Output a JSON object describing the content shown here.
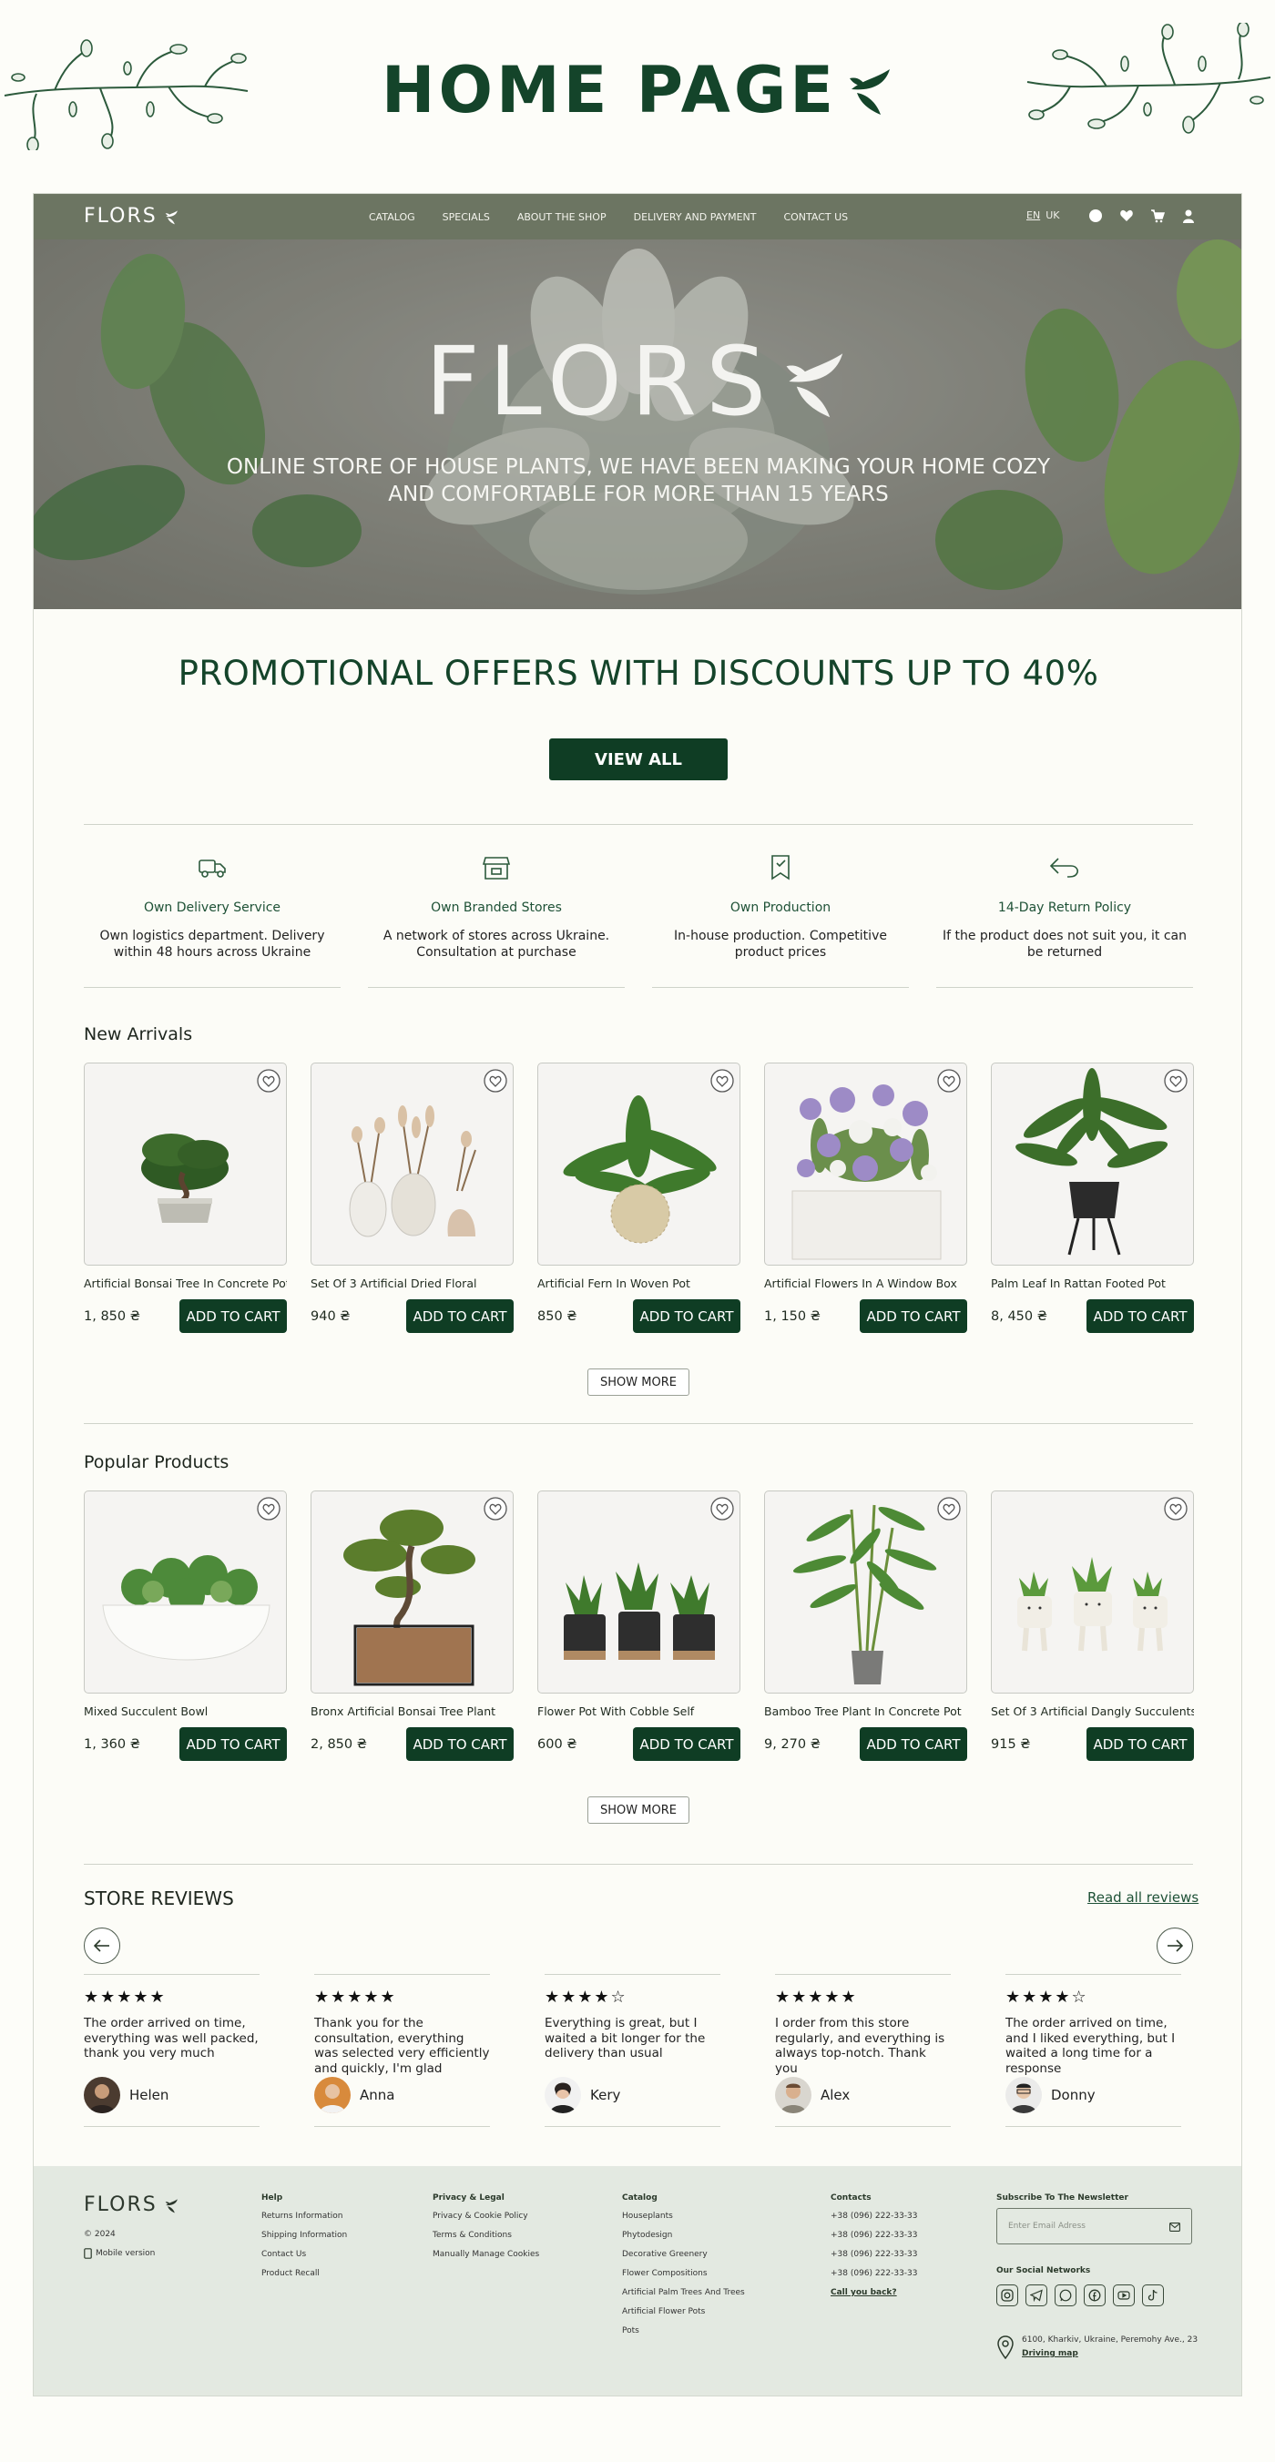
{
  "page_title": "HOME PAGE",
  "header": {
    "logo": "FLORS",
    "nav": [
      "CATALOG",
      "SPECIALS",
      "ABOUT THE SHOP",
      "DELIVERY AND PAYMENT",
      "CONTACT US"
    ],
    "lang": [
      "EN",
      "UK"
    ],
    "icons": [
      "search-icon",
      "heart-icon",
      "cart-icon",
      "user-icon"
    ]
  },
  "hero": {
    "logo": "FLORS",
    "text": "ONLINE STORE OF HOUSE PLANTS, WE HAVE BEEN MAKING YOUR HOME COZY AND COMFORTABLE FOR MORE THAN 15 YEARS"
  },
  "promo": {
    "title": "PROMOTIONAL OFFERS WITH DISCOUNTS UP TO 40%",
    "button": "VIEW ALL"
  },
  "features": [
    {
      "icon": "delivery-truck-icon",
      "title": "Own Delivery Service",
      "text": "Own logistics department. Delivery within 48 hours across Ukraine"
    },
    {
      "icon": "store-icon",
      "title": "Own Branded Stores",
      "text": "A network of stores across Ukraine. Consultation at purchase"
    },
    {
      "icon": "production-tag-icon",
      "title": "Own Production",
      "text": "In-house production. Competitive product prices"
    },
    {
      "icon": "return-arrow-icon",
      "title": "14-Day Return Policy",
      "text": "If the product does not suit you, it can be returned"
    }
  ],
  "new_arrivals": {
    "title": "New Arrivals",
    "show_more": "SHOW MORE",
    "items": [
      {
        "name": "Artificial Bonsai Tree In Concrete Pot",
        "price": "1, 850 ₴",
        "button": "ADD TO CART"
      },
      {
        "name": "Set Of 3 Artificial Dried Floral",
        "price": "940 ₴",
        "button": "ADD TO CART"
      },
      {
        "name": "Artificial Fern In Woven Pot",
        "price": "850 ₴",
        "button": "ADD TO CART"
      },
      {
        "name": "Artificial Flowers In A Window Box",
        "price": "1, 150 ₴",
        "button": "ADD TO CART"
      },
      {
        "name": "Palm Leaf In Rattan Footed Pot",
        "price": "8, 450 ₴",
        "button": "ADD TO CART"
      }
    ]
  },
  "popular": {
    "title": "Popular Products",
    "show_more": "SHOW MORE",
    "items": [
      {
        "name": "Mixed Succulent Bowl",
        "price": "1, 360 ₴",
        "button": "ADD TO CART"
      },
      {
        "name": "Bronx Artificial Bonsai Tree Plant",
        "price": "2, 850 ₴",
        "button": "ADD TO CART"
      },
      {
        "name": "Flower Pot With Cobble Self",
        "price": "600 ₴",
        "button": "ADD TO CART"
      },
      {
        "name": "Bamboo Tree Plant In Concrete Pot",
        "price": "9, 270 ₴",
        "button": "ADD TO CART"
      },
      {
        "name": "Set Of 3 Artificial Dangly Succulents",
        "price": "915 ₴",
        "button": "ADD TO CART"
      }
    ]
  },
  "reviews": {
    "title": "STORE REVIEWS",
    "read_all": "Read all reviews",
    "items": [
      {
        "stars": "★★★★★",
        "rating": 5,
        "text": "The order arrived on time, everything was well packed, thank you very much",
        "name": "Helen"
      },
      {
        "stars": "★★★★★",
        "rating": 5,
        "text": "Thank you for the consultation, everything was selected very efficiently and quickly, I'm glad",
        "name": "Anna"
      },
      {
        "stars": "★★★★☆",
        "rating": 4,
        "text": "Everything is great, but I waited a bit longer for the delivery than usual",
        "name": "Kery"
      },
      {
        "stars": "★★★★★",
        "rating": 5,
        "text": "I order from this store regularly, and everything is always top-notch. Thank you",
        "name": "Alex"
      },
      {
        "stars": "★★★★☆",
        "rating": 4,
        "text": "The order arrived on time, and I liked everything, but I waited a long time for a response",
        "name": "Donny"
      }
    ]
  },
  "footer": {
    "logo": "FLORS",
    "copyright": "© 2024",
    "mobile": "Mobile version",
    "help": {
      "title": "Help",
      "items": [
        "Returns Information",
        "Shipping Information",
        "Contact Us",
        "Product Recall"
      ]
    },
    "privacy": {
      "title": "Privacy & Legal",
      "items": [
        "Privacy & Cookie Policy",
        "Terms & Conditions",
        "Manually Manage Cookies"
      ]
    },
    "catalog": {
      "title": "Catalog",
      "items": [
        "Houseplants",
        "Phytodesign",
        "Decorative Greenery",
        "Flower Compositions",
        "Artificial Palm Trees And Trees",
        "Artificial Flower Pots",
        "Pots"
      ]
    },
    "contacts": {
      "title": "Contacts",
      "items": [
        "+38 (096) 222-33-33",
        "+38 (096) 222-33-33",
        "+38 (096) 222-33-33",
        "+38 (096) 222-33-33"
      ],
      "call_back": "Call you back?"
    },
    "newsletter": {
      "title": "Subscribe To The Newsletter",
      "placeholder": "Enter Email Adress"
    },
    "social_title": "Our Social Networks",
    "socials": [
      "instagram-icon",
      "telegram-icon",
      "whatsapp-icon",
      "facebook-icon",
      "youtube-icon",
      "tiktok-icon"
    ],
    "address": "6100, Kharkiv, Ukraine, Peremohy Ave., 23",
    "map": "Driving map"
  }
}
